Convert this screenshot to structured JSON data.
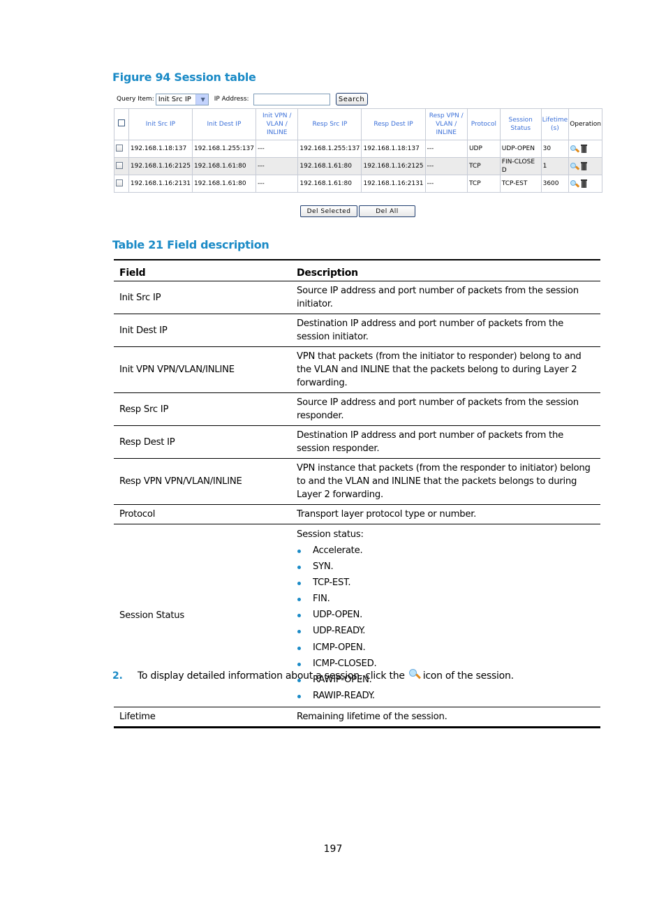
{
  "figure": {
    "caption": "Figure 94 Session table",
    "query": {
      "query_item_label": "Query Item:",
      "query_item_value": "Init Src IP",
      "ip_address_label": "IP Address:",
      "ip_address_value": "",
      "search_label": "Search"
    },
    "table": {
      "headers": [
        "Init Src IP",
        "Init Dest IP",
        "Init VPN / VLAN / INLINE",
        "Resp Src IP",
        "Resp Dest IP",
        "Resp VPN / VLAN / INLINE",
        "Protocol",
        "Session Status",
        "Lifetime (s)",
        "Operation"
      ],
      "rows": [
        [
          "192.168.1.18:137",
          "192.168.1.255:137",
          "---",
          "192.168.1.255:137",
          "192.168.1.18:137",
          "---",
          "UDP",
          "UDP-OPEN",
          "30"
        ],
        [
          "192.168.1.16:2125",
          "192.168.1.61:80",
          "---",
          "192.168.1.61:80",
          "192.168.1.16:2125",
          "---",
          "TCP",
          "FIN-CLOSED",
          "1"
        ],
        [
          "192.168.1.16:2131",
          "192.168.1.61:80",
          "---",
          "192.168.1.61:80",
          "192.168.1.16:2131",
          "---",
          "TCP",
          "TCP-EST",
          "3600"
        ]
      ],
      "operation_icons": [
        "zoom-detail-icon",
        "trash-icon"
      ]
    },
    "buttons": {
      "del_selected": "Del Selected",
      "del_all": "Del All"
    }
  },
  "field_table": {
    "caption": "Table 21 Field description",
    "headers": [
      "Field",
      "Description"
    ],
    "rows": [
      {
        "field": "Init Src IP",
        "description": "Source IP address and port number of packets from the session initiator."
      },
      {
        "field": "Init Dest IP",
        "description": "Destination IP address and port number of packets from the session initiator."
      },
      {
        "field": "Init VPN VPN/VLAN/INLINE",
        "description": "VPN that packets (from the initiator to responder) belong to and the VLAN and INLINE that the packets belong to during Layer 2 forwarding."
      },
      {
        "field": "Resp Src IP",
        "description": "Source IP address and port number of packets from the session responder."
      },
      {
        "field": "Resp Dest IP",
        "description": "Destination IP address and port number of packets from the session responder."
      },
      {
        "field": "Resp VPN VPN/VLAN/INLINE",
        "description": "VPN instance that packets (from the responder to initiator) belong to and the VLAN and INLINE that the packets belongs to during Layer 2 forwarding."
      },
      {
        "field": "Protocol",
        "description": "Transport layer protocol type or number."
      },
      {
        "field": "Session Status",
        "description": "Session status:",
        "bullets": [
          "Accelerate.",
          "SYN.",
          "TCP-EST.",
          "FIN.",
          "UDP-OPEN.",
          "UDP-READY.",
          "ICMP-OPEN.",
          "ICMP-CLOSED.",
          "RAWIP-OPEN.",
          "RAWIP-READY."
        ]
      },
      {
        "field": "Lifetime",
        "description": "Remaining lifetime of the session."
      }
    ]
  },
  "step": {
    "number": "2.",
    "text_before": "To display detailed information about a session, click the",
    "text_after": "icon of the session."
  },
  "page_number": "197"
}
